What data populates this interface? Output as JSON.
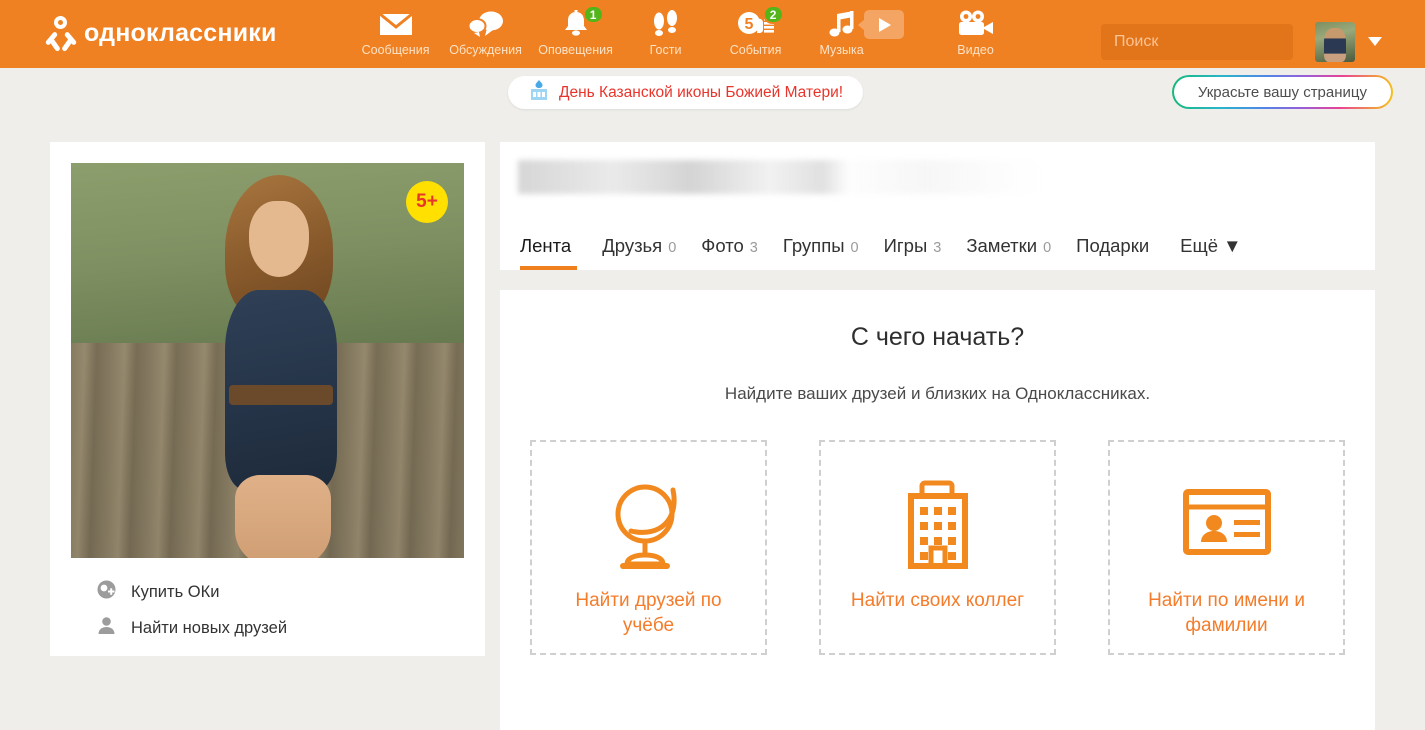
{
  "header": {
    "brand": "одноклассники",
    "brand_icon": "ok-logo-icon",
    "nav": [
      {
        "label": "Сообщения",
        "icon": "envelope-icon",
        "badge": ""
      },
      {
        "label": "Обсуждения",
        "icon": "chat-bubbles-icon",
        "badge": ""
      },
      {
        "label": "Оповещения",
        "icon": "bell-icon",
        "badge": "1"
      },
      {
        "label": "Гости",
        "icon": "footprints-icon",
        "badge": ""
      },
      {
        "label": "События",
        "icon": "calendar-hand-icon",
        "badge": "2"
      },
      {
        "label": "Музыка",
        "icon": "music-note-icon",
        "badge": ""
      },
      {
        "label": "Видео",
        "icon": "video-camera-icon",
        "badge": ""
      }
    ],
    "play_button_icon": "play-icon",
    "search": {
      "placeholder": "Поиск",
      "value": "",
      "icon": "search-icon"
    },
    "avatar_icon": "user-avatar",
    "caret_icon": "chevron-down-icon",
    "bg_color": "#F08122",
    "badge_color": "#52B519"
  },
  "subbar": {
    "holiday": {
      "text": "День Казанской иконы Божией Матери!",
      "icon": "church-icon",
      "color": "#E8352B"
    },
    "decorate": {
      "label": "Украсьте вашу страницу"
    }
  },
  "sidebar": {
    "photo_badge": "5+",
    "links": [
      {
        "label": "Купить ОКи",
        "icon": "ok-coin-icon"
      },
      {
        "label": "Найти новых друзей",
        "icon": "person-icon"
      }
    ]
  },
  "profile": {
    "name": "",
    "tabs": [
      {
        "label": "Лента",
        "count": "",
        "active": true
      },
      {
        "label": "Друзья",
        "count": "0",
        "active": false
      },
      {
        "label": "Фото",
        "count": "3",
        "active": false
      },
      {
        "label": "Группы",
        "count": "0",
        "active": false
      },
      {
        "label": "Игры",
        "count": "3",
        "active": false
      },
      {
        "label": "Заметки",
        "count": "0",
        "active": false
      },
      {
        "label": "Подарки",
        "count": "",
        "active": false
      }
    ],
    "more_label": "Ещё ▼"
  },
  "start": {
    "title": "С чего начать?",
    "subtitle": "Найдите ваших друзей и близких на Одноклассниках.",
    "options": [
      {
        "label": "Найти друзей по учёбе",
        "icon": "globe-icon"
      },
      {
        "label": "Найти своих коллег",
        "icon": "building-icon"
      },
      {
        "label": "Найти по имени и фамилии",
        "icon": "id-card-icon"
      }
    ],
    "accent_color": "#F47C2B"
  }
}
